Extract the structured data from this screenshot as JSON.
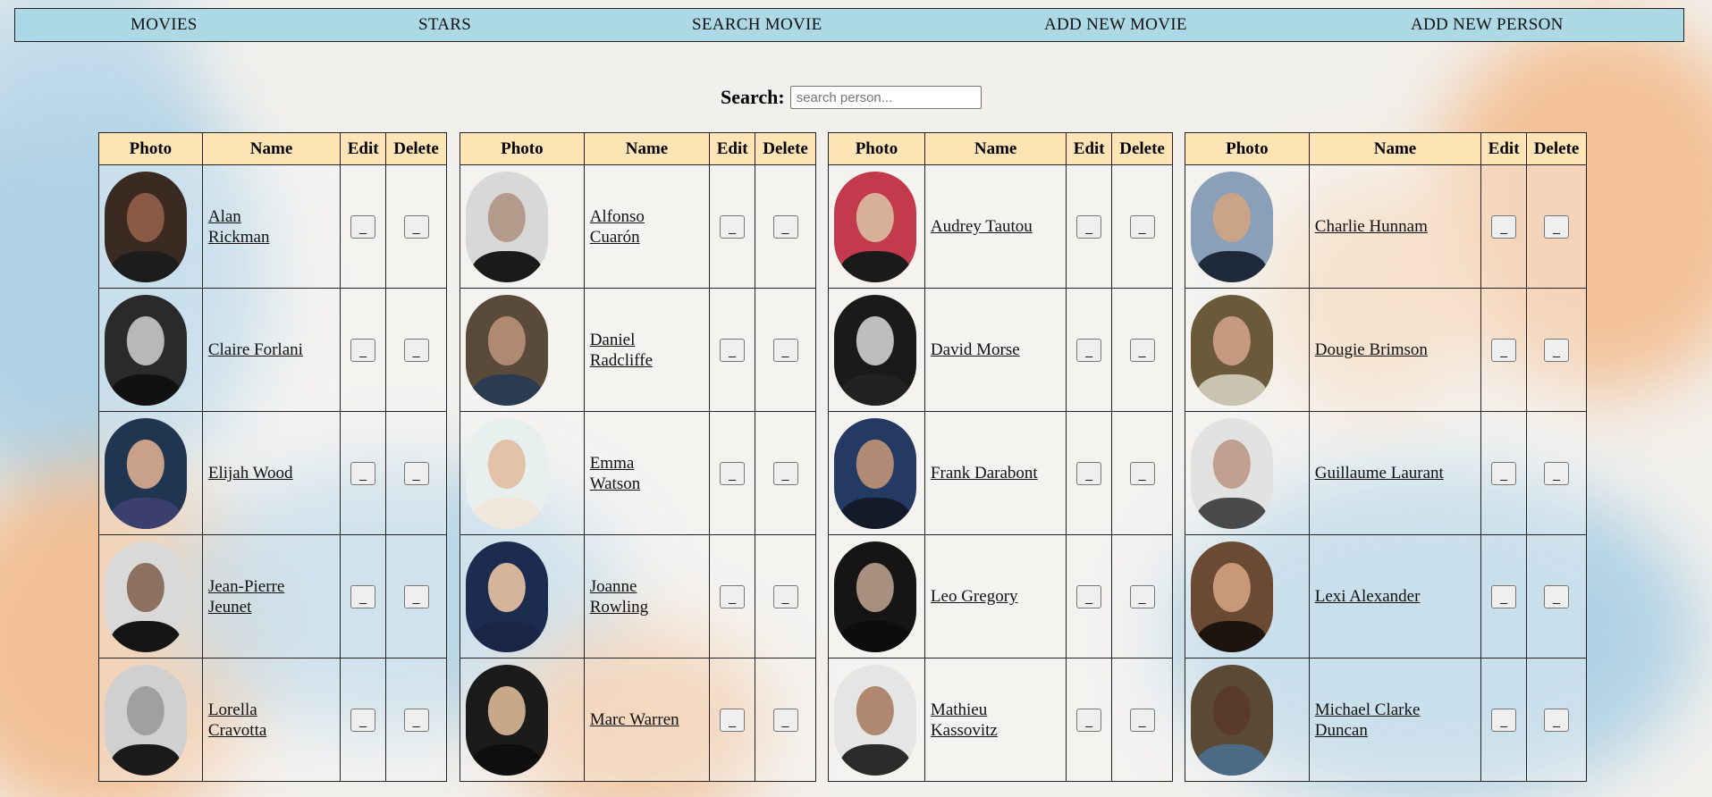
{
  "nav": {
    "movies": "MOVIES",
    "stars": "STARS",
    "search_movie": "SEARCH MOVIE",
    "add_movie": "ADD NEW MOVIE",
    "add_person": "ADD NEW PERSON"
  },
  "search": {
    "label": "Search:",
    "placeholder": "search person..."
  },
  "columns": {
    "photo": "Photo",
    "name": "Name",
    "edit": "Edit",
    "delete": "Delete"
  },
  "button_label": "_",
  "tables": [
    {
      "people": [
        {
          "name": "Alan Rickman",
          "tone": "#8a5a44",
          "bg": "#3b2a22",
          "cloth": "#1c1c1c"
        },
        {
          "name": "Claire Forlani",
          "tone": "#b8b8b8",
          "bg": "#2a2a2a",
          "cloth": "#111111"
        },
        {
          "name": "Elijah Wood",
          "tone": "#c9a08a",
          "bg": "#1f3550",
          "cloth": "#3a3f6e"
        },
        {
          "name": "Jean-Pierre Jeunet",
          "tone": "#8c7060",
          "bg": "#d9d9d9",
          "cloth": "#151515"
        },
        {
          "name": "Lorella Cravotta",
          "tone": "#a0a0a0",
          "bg": "#d0d0d0",
          "cloth": "#1a1a1a"
        }
      ]
    },
    {
      "people": [
        {
          "name": "Alfonso Cuarón",
          "tone": "#b49a8a",
          "bg": "#d8d8d8",
          "cloth": "#1a1a1a"
        },
        {
          "name": "Daniel Radcliffe",
          "tone": "#b08a70",
          "bg": "#5a4a3a",
          "cloth": "#2b3b52"
        },
        {
          "name": "Emma Watson",
          "tone": "#e2c2a8",
          "bg": "#e8f0ef",
          "cloth": "#f0e6dc"
        },
        {
          "name": "Joanne Rowling",
          "tone": "#d4b49a",
          "bg": "#1c2c4e",
          "cloth": "#1b2548"
        },
        {
          "name": "Marc Warren",
          "tone": "#c8a88a",
          "bg": "#1b1b1b",
          "cloth": "#0e0e0e"
        }
      ]
    },
    {
      "people": [
        {
          "name": "Audrey Tautou",
          "tone": "#d8b09a",
          "bg": "#c23a4c",
          "cloth": "#1a1a1a"
        },
        {
          "name": "David Morse",
          "tone": "#bdbdbd",
          "bg": "#1a1a1a",
          "cloth": "#222222"
        },
        {
          "name": "Frank Darabont",
          "tone": "#b08a74",
          "bg": "#243a63",
          "cloth": "#151a2b"
        },
        {
          "name": "Leo Gregory",
          "tone": "#a89080",
          "bg": "#151515",
          "cloth": "#0d0d0d"
        },
        {
          "name": "Mathieu Kassovitz",
          "tone": "#b08870",
          "bg": "#e5e5e5",
          "cloth": "#2b2b2b"
        }
      ]
    },
    {
      "people": [
        {
          "name": "Charlie Hunnam",
          "tone": "#caa488",
          "bg": "#8aa0b8",
          "cloth": "#1e2a3a"
        },
        {
          "name": "Dougie Brimson",
          "tone": "#c69a80",
          "bg": "#6b5a3a",
          "cloth": "#c8c4b0"
        },
        {
          "name": "Guillaume Laurant",
          "tone": "#c2a090",
          "bg": "#e2e2e2",
          "cloth": "#4a4a4a"
        },
        {
          "name": "Lexi Alexander",
          "tone": "#c89878",
          "bg": "#6a4a32",
          "cloth": "#1d1410"
        },
        {
          "name": "Michael Clarke Duncan",
          "tone": "#5a3a2a",
          "bg": "#5a4a36",
          "cloth": "#4a6a86"
        }
      ]
    }
  ]
}
